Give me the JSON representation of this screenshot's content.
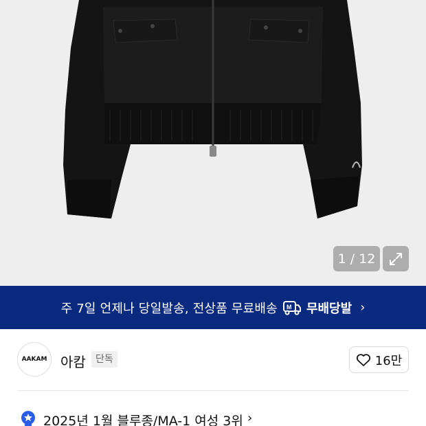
{
  "gallery": {
    "counter": "1 / 12",
    "expand_icon": "expand-icon"
  },
  "banner": {
    "text": "주 7일 언제나 당일발송, 전상품 무료배송",
    "brand": "무배당발",
    "icon": "delivery-truck-m-icon",
    "color": "#0a2a80"
  },
  "store": {
    "logo_text": "AAKAM",
    "name": "아캄",
    "tag": "단독",
    "like_count": "16만",
    "like_icon": "heart-icon"
  },
  "ranking": {
    "text": "2025년 1월 블루종/MA-1 여성 3위",
    "badge_color": "#2a5de8"
  }
}
